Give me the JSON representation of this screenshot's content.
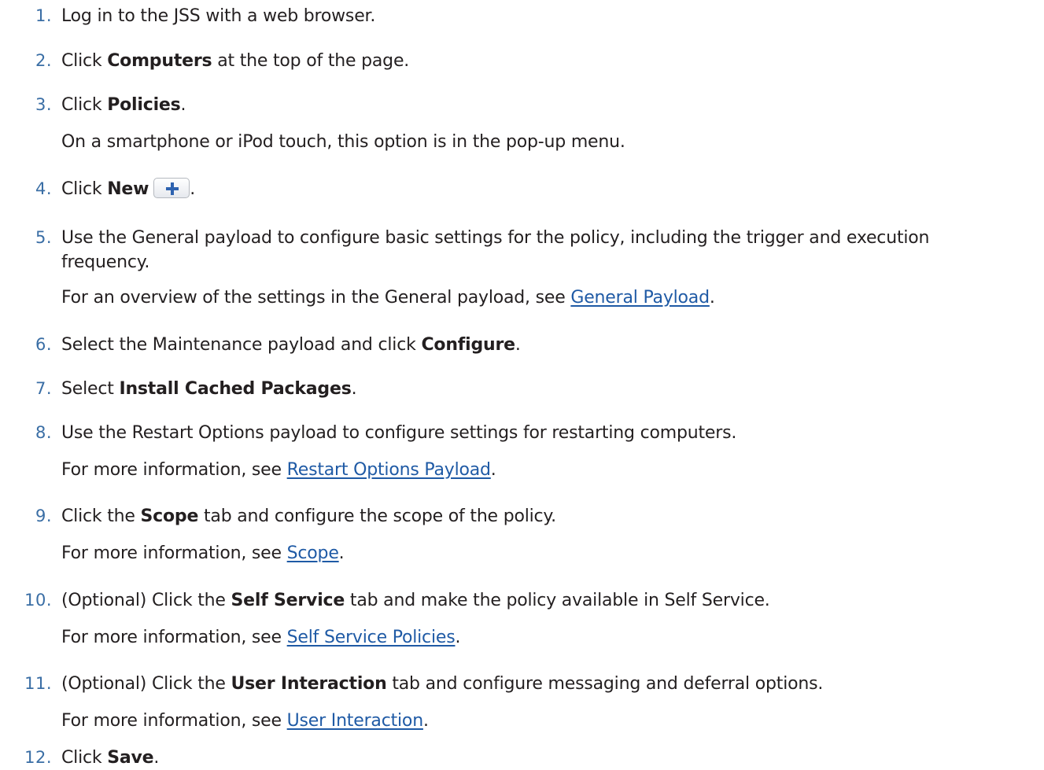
{
  "steps": [
    {
      "num": "1.",
      "text": "Log in to the JSS with a web browser."
    },
    {
      "num": "2.",
      "pre": "Click ",
      "bold": "Computers",
      "post": " at the top of the page."
    },
    {
      "num": "3.",
      "pre": "Click ",
      "bold": "Policies",
      "post": ".",
      "note": "On a smartphone or iPod touch, this option is in the pop-up menu."
    },
    {
      "num": "4.",
      "pre": "Click ",
      "bold": "New",
      "post": "."
    },
    {
      "num": "5.",
      "line1": "Use the General payload to configure basic settings for the policy, including the trigger and execution",
      "line2": "frequency.",
      "note_pre": "For an overview of the settings in the General payload, see ",
      "link": "General Payload",
      "note_post": "."
    },
    {
      "num": "6.",
      "pre": "Select the Maintenance payload and click ",
      "bold": "Configure",
      "post": "."
    },
    {
      "num": "7.",
      "pre": "Select ",
      "bold": "Install Cached Packages",
      "post": "."
    },
    {
      "num": "8.",
      "text": "Use the Restart Options payload to configure settings for restarting computers.",
      "note_pre": "For more information, see ",
      "link": " Restart Options Payload",
      "note_post": "."
    },
    {
      "num": "9.",
      "pre": "Click the ",
      "bold": "Scope",
      "post": " tab and configure the scope of the policy.",
      "note_pre": "For more information, see ",
      "link": "Scope",
      "note_post": "."
    },
    {
      "num": "10.",
      "pre": "(Optional) Click the ",
      "bold": "Self Service",
      "post": " tab and make the policy available in Self Service.",
      "note_pre": "For more information, see ",
      "link": "Self Service Policies",
      "note_post": "."
    },
    {
      "num": "11.",
      "pre": "(Optional) Click the ",
      "bold": "User Interaction",
      "post": " tab and configure messaging and deferral options.",
      "note_pre": "For more information, see ",
      "link": "User Interaction",
      "note_post": "."
    },
    {
      "num": "12.",
      "pre": "Click ",
      "bold": "Save",
      "post": "."
    }
  ],
  "new_button": {
    "icon": "plus-icon"
  }
}
